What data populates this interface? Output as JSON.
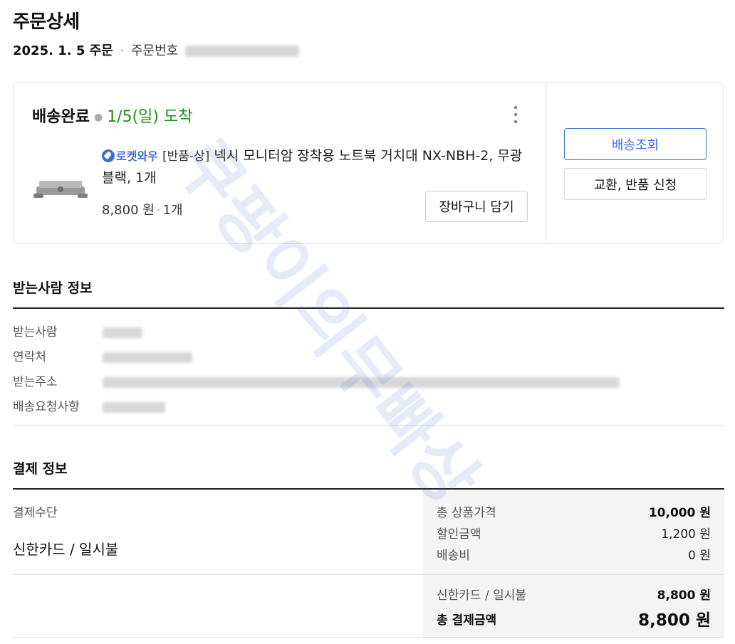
{
  "page": {
    "title": "주문상세",
    "order_date": "2025. 1. 5 주문",
    "order_number_label": "주문번호"
  },
  "delivery": {
    "status": "배송완료",
    "arrival": "1/5(일) 도착",
    "product": {
      "badge": "로켓와우",
      "tag": "[반품-상]",
      "name": "넥시 모니터암 장착용 노트북 거치대 NX-NBH-2, 무광 블랙, 1개",
      "price": "8,800 원",
      "quantity": "1개"
    },
    "cart_button": "장바구니 담기",
    "track_button": "배송조회",
    "return_button": "교환, 반품 신청"
  },
  "recipient": {
    "title": "받는사람 정보",
    "rows": [
      {
        "label": "받는사람"
      },
      {
        "label": "연락처"
      },
      {
        "label": "받는주소"
      },
      {
        "label": "배송요청사항"
      }
    ]
  },
  "payment": {
    "title": "결제 정보",
    "method_label": "결제수단",
    "method_value": "신한카드 / 일시불",
    "lines": [
      {
        "label": "총 상품가격",
        "value": "10,000 원"
      },
      {
        "label": "할인금액",
        "value": "1,200 원"
      },
      {
        "label": "배송비",
        "value": "0 원"
      }
    ],
    "card_label": "신한카드 / 일시불",
    "card_value": "8,800 원",
    "total_label": "총 결제금액",
    "total_value": "8,800 원"
  },
  "watermark": "쿠팡이의무빠상",
  "colors": {
    "arrival": "#1a8f1a",
    "accent": "#3d6fd6",
    "summary_bg": "#f4f4f4"
  },
  "icons": {
    "more": "kebab-menu-icon",
    "rocket": "rocket-icon"
  }
}
